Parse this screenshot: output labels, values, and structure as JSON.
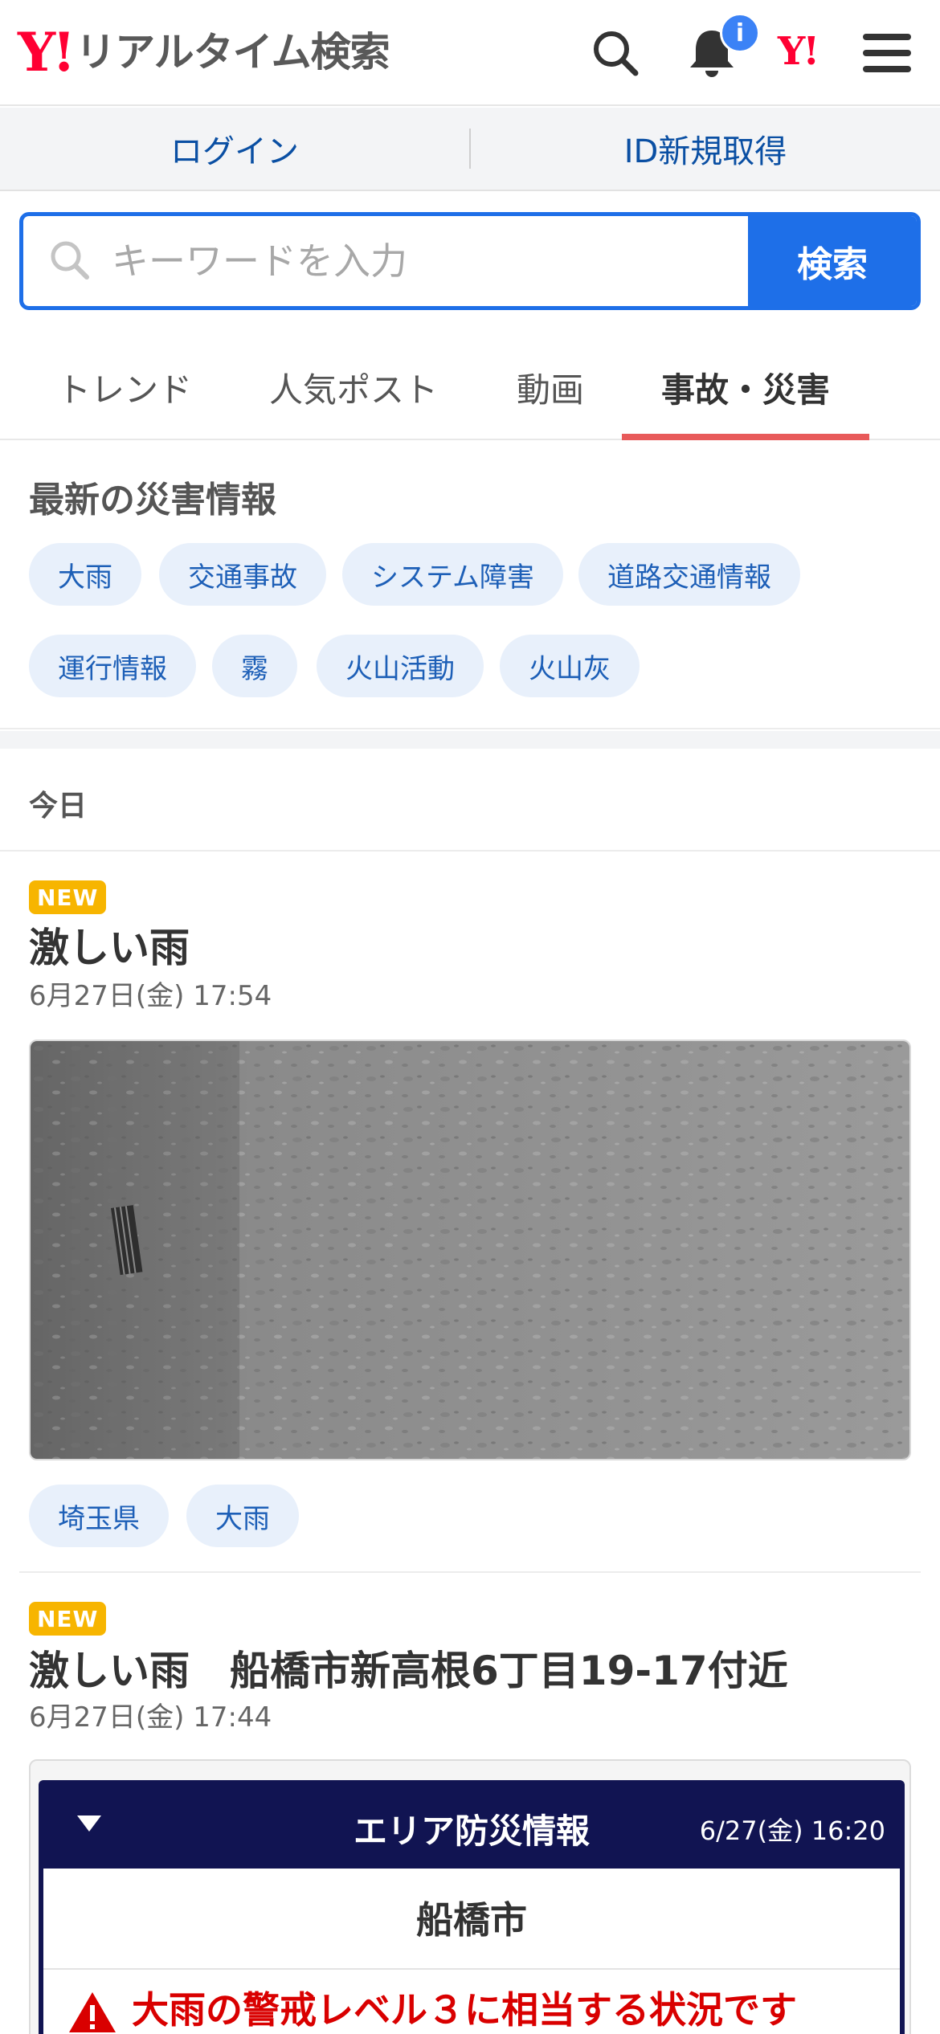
{
  "header": {
    "logo_mark": "Y!",
    "logo_text": "リアルタイム検索",
    "notification_badge": "i",
    "yahoo_small": "Y!"
  },
  "auth": {
    "login": "ログイン",
    "register": "ID新規取得"
  },
  "search": {
    "placeholder": "キーワードを入力",
    "button": "検索"
  },
  "tabs": [
    "トレンド",
    "人気ポスト",
    "動画",
    "事故・災害"
  ],
  "disaster_info": {
    "title": "最新の災害情報",
    "chips": [
      "大雨",
      "交通事故",
      "システム障害",
      "道路交通情報",
      "運行情報",
      "霧",
      "火山活動",
      "火山灰"
    ]
  },
  "section_day": "今日",
  "posts": [
    {
      "badge": "NEW",
      "title": "激しい雨",
      "time": "6月27日(金) 17:54",
      "tags": [
        "埼玉県",
        "大雨"
      ]
    },
    {
      "badge": "NEW",
      "title": "激しい雨　船橋市新高根6丁目19-17付近",
      "time": "6月27日(金) 17:44"
    }
  ],
  "area_widget": {
    "title": "エリア防災情報",
    "datetime": "6/27(金) 16:20",
    "city": "船橋市",
    "warning": "大雨の警戒レベル３に相当する状況です"
  },
  "colors": {
    "brand_red": "#ff0033",
    "accent_blue": "#1e6fe8",
    "active_tab_underline": "#e85a5a",
    "new_badge": "#f7b500",
    "widget_navy": "#111452",
    "warning_red": "#d90000"
  }
}
